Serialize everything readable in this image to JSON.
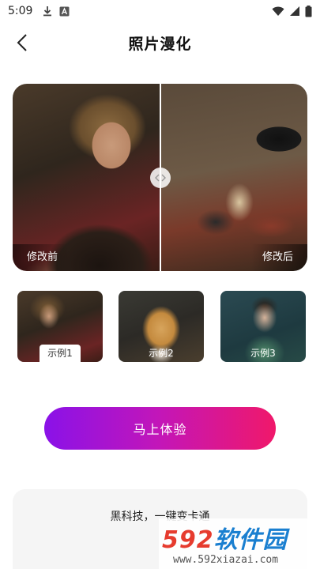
{
  "status_bar": {
    "time": "5:09"
  },
  "header": {
    "title": "照片漫化"
  },
  "compare": {
    "before_label": "修改前",
    "after_label": "修改后"
  },
  "examples": [
    {
      "label": "示例1",
      "selected": true
    },
    {
      "label": "示例2",
      "selected": false
    },
    {
      "label": "示例3",
      "selected": false
    }
  ],
  "cta": {
    "label": "马上体验",
    "gradient": [
      "#8a12e8",
      "#f0186a"
    ]
  },
  "info": {
    "text": "黑科技，一键变卡通"
  },
  "watermark": {
    "logo_num": "592",
    "logo_text": "软件园",
    "url": "www.592xiazai.com"
  }
}
